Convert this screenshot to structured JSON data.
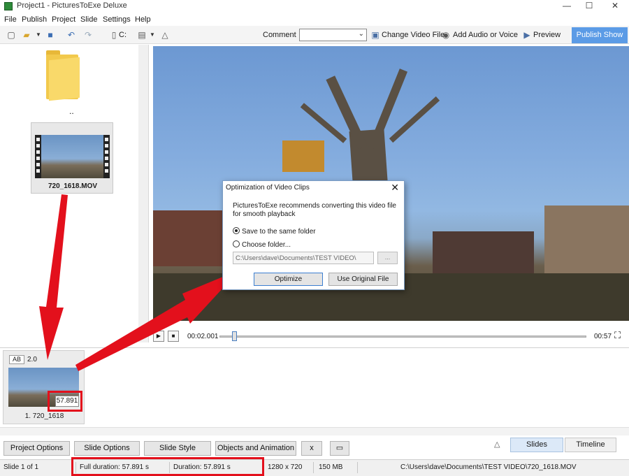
{
  "window": {
    "title": "Project1 - PicturesToExe Deluxe",
    "controls": [
      "—",
      "☐",
      "✕"
    ]
  },
  "menu": [
    "File",
    "Publish",
    "Project",
    "Slide",
    "Settings",
    "Help"
  ],
  "toolbar": {
    "drive_label": "C:",
    "comment_label": "Comment",
    "comment_value": "",
    "change_video_label": "Change Video File",
    "add_audio_label": "Add Audio or Voice",
    "preview_label": "Preview",
    "publish_label": "Publish Show"
  },
  "file_panel": {
    "parent_folder_label": "..",
    "file_name": "720_1618.MOV"
  },
  "playback": {
    "current_time": "00:02.001",
    "total_time": "00:57",
    "progress_fraction": 0.035
  },
  "slide": {
    "ab_label": "AB",
    "transition_duration": "2.0",
    "time_label": "57.891",
    "name": "1. 720_1618"
  },
  "dialog": {
    "title": "Optimization of Video Clips",
    "message": "PicturesToExe recommends converting this video file for smooth playback",
    "option_same_folder": "Save to the same folder",
    "option_choose_folder": "Choose folder...",
    "selected_option": "Save to the same folder",
    "folder_path": "C:\\Users\\dave\\Documents\\TEST VIDEO\\",
    "browse_label": "...",
    "optimize_label": "Optimize",
    "use_original_label": "Use Original File"
  },
  "bottom_buttons": {
    "project_options": "Project Options",
    "slide_options": "Slide Options",
    "slide_style": "Slide Style",
    "objects_animation": "Objects and Animation",
    "x_label": "x",
    "slides_tab": "Slides",
    "timeline_tab": "Timeline"
  },
  "status": {
    "slide_count": "Slide 1 of 1",
    "full_duration": "Full duration: 57.891 s",
    "duration": "Duration: 57.891 s",
    "resolution": "1280 x 720",
    "file_size": "150 MB",
    "file_path": "C:\\Users\\dave\\Documents\\TEST VIDEO\\720_1618.MOV"
  },
  "colors": {
    "accent": "#5b9be6",
    "annotation": "#e3101c"
  }
}
